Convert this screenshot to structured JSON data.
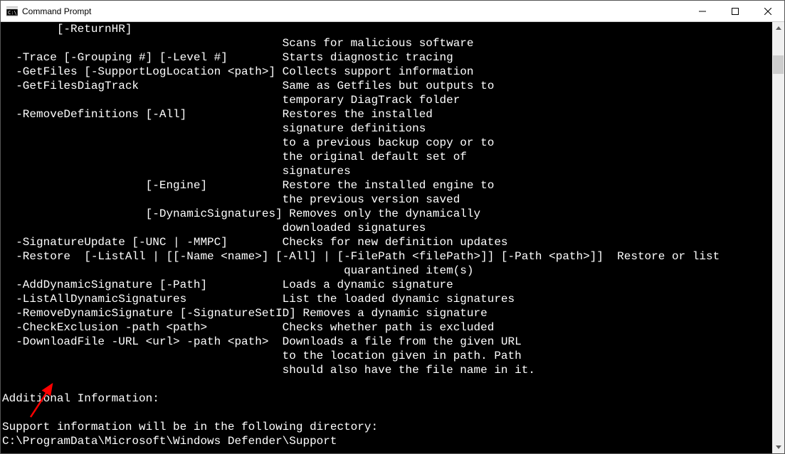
{
  "window": {
    "title": "Command Prompt"
  },
  "console": {
    "lines": [
      "        [-ReturnHR]",
      "                                         Scans for malicious software",
      "  -Trace [-Grouping #] [-Level #]        Starts diagnostic tracing",
      "  -GetFiles [-SupportLogLocation <path>] Collects support information",
      "  -GetFilesDiagTrack                     Same as Getfiles but outputs to",
      "                                         temporary DiagTrack folder",
      "  -RemoveDefinitions [-All]              Restores the installed",
      "                                         signature definitions",
      "                                         to a previous backup copy or to",
      "                                         the original default set of",
      "                                         signatures",
      "                     [-Engine]           Restore the installed engine to",
      "                                         the previous version saved",
      "                     [-DynamicSignatures] Removes only the dynamically",
      "                                         downloaded signatures",
      "  -SignatureUpdate [-UNC | -MMPC]        Checks for new definition updates",
      "  -Restore  [-ListAll | [[-Name <name>] [-All] | [-FilePath <filePath>]] [-Path <path>]]  Restore or list",
      "                                                  quarantined item(s)",
      "  -AddDynamicSignature [-Path]           Loads a dynamic signature",
      "  -ListAllDynamicSignatures              List the loaded dynamic signatures",
      "  -RemoveDynamicSignature [-SignatureSetID] Removes a dynamic signature",
      "  -CheckExclusion -path <path>           Checks whether path is excluded",
      "  -DownloadFile -URL <url> -path <path>  Downloads a file from the given URL",
      "                                         to the location given in path. Path",
      "                                         should also have the file name in it.",
      "",
      "Additional Information:",
      "",
      "Support information will be in the following directory:",
      "C:\\ProgramData\\Microsoft\\Windows Defender\\Support"
    ]
  }
}
